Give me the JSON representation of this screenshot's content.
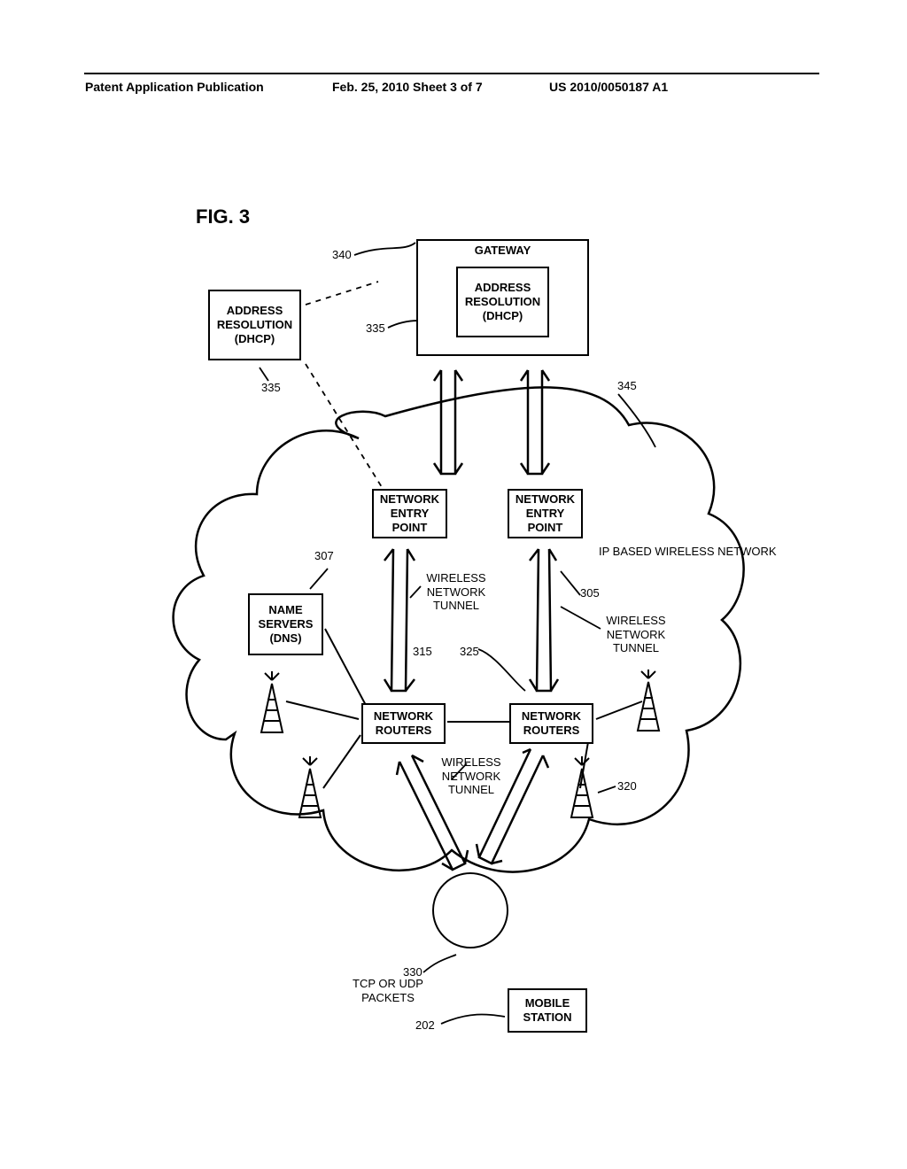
{
  "header": {
    "left": "Patent Application Publication",
    "center": "Feb. 25, 2010  Sheet 3 of 7",
    "right": "US 2010/0050187 A1"
  },
  "figure_title": "FIG. 3",
  "boxes": {
    "gateway": "GATEWAY",
    "dhcp": "ADDRESS RESOLUTION (DHCP)",
    "dhcp_ext": "ADDRESS RESOLUTION (DHCP)",
    "nep": "NETWORK ENTRY POINT",
    "dns": "NAME SERVERS (DNS)",
    "router": "NETWORK ROUTERS",
    "mobile_station": "MOBILE STATION"
  },
  "labels": {
    "wireless_network_tunnel": "WIRELESS NETWORK TUNNEL",
    "ip_based": "IP BASED WIRELESS NETWORK",
    "tcp_udp": "TCP OR UDP PACKETS"
  },
  "refs": {
    "r340": "340",
    "r335": "335",
    "r345": "345",
    "r307": "307",
    "r305": "305",
    "r315": "315",
    "r325": "325",
    "r320": "320",
    "r330": "330",
    "r202": "202"
  }
}
